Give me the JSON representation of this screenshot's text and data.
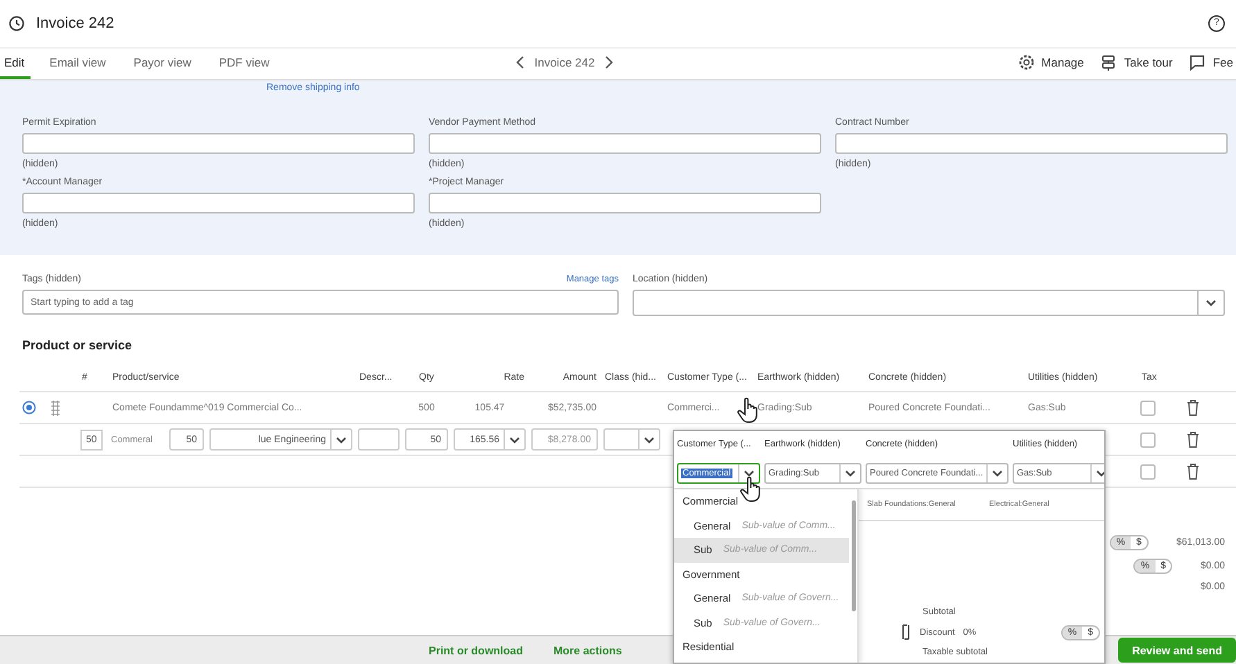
{
  "header": {
    "title": "Invoice 242",
    "help": "?"
  },
  "tabs": [
    {
      "label": "Edit",
      "selected": true
    },
    {
      "label": "Email view",
      "selected": false
    },
    {
      "label": "Payor view",
      "selected": false
    },
    {
      "label": "PDF view",
      "selected": false
    }
  ],
  "pager": {
    "title": "Invoice 242"
  },
  "toolbar": [
    {
      "label": "Manage"
    },
    {
      "label": "Take tour"
    },
    {
      "label": "Fee"
    }
  ],
  "shipping_link": "Remove shipping info",
  "custom_fields": [
    {
      "label": "Permit Expiration",
      "note": "(hidden)"
    },
    {
      "label": "Vendor Payment Method",
      "note": "(hidden)"
    },
    {
      "label": "Contract Number",
      "note": "(hidden)"
    },
    {
      "label": "*Account Manager",
      "note": "(hidden)"
    },
    {
      "label": "*Project Manager",
      "note": "(hidden)"
    }
  ],
  "tags": {
    "label": "Tags (hidden)",
    "manage_link": "Manage tags",
    "placeholder": "Start typing to add a tag"
  },
  "location": {
    "label": "Location (hidden)"
  },
  "section_title": "Product or service",
  "table": {
    "columns": [
      "#",
      "Product/service",
      "Descr...",
      "Qty",
      "Rate",
      "Amount",
      "Class (hid...",
      "Customer Type (...",
      "Earthwork (hidden)",
      "Concrete (hidden)",
      "Utilities (hidden)",
      "Tax"
    ],
    "rows": [
      {
        "kind": "item",
        "product": "Comete Foundamme^019 Commercial Co...",
        "qty": "500",
        "rate": "105.47",
        "amount": "$52,735.00",
        "customer_type": "Commerci...",
        "earthwork": "Grading:Sub",
        "concrete": "Poured Concrete Foundati...",
        "utilities": "Gas:Sub",
        "taxable": false
      },
      {
        "kind": "editing",
        "badge": "50",
        "product_text": "Commeral",
        "product_qty": "50",
        "product": "lue Engineering",
        "qty": "50",
        "rate": "165.56",
        "amount": "$8,278.00",
        "taxable": false
      },
      {
        "kind": "empty",
        "taxable": false
      }
    ]
  },
  "popup": {
    "columns": [
      "Customer Type (...",
      "Earthwork (hidden)",
      "Concrete (hidden)",
      "Utilities (hidden)"
    ],
    "selects": [
      {
        "value": "Commercial",
        "selected": true
      },
      {
        "value": "Grading:Sub",
        "selected": false
      },
      {
        "value": "Poured Concrete Foundati...",
        "selected": false
      },
      {
        "value": "Gas:Sub",
        "selected": false
      }
    ],
    "options": [
      {
        "kind": "group",
        "label": "Commercial",
        "selected": false
      },
      {
        "kind": "sub",
        "label": "General",
        "hint": "Sub-value of Comm...",
        "selected": false
      },
      {
        "kind": "sub",
        "label": "Sub",
        "hint": "Sub-value of Comm...",
        "selected": true
      },
      {
        "kind": "group",
        "label": "Government",
        "selected": false
      },
      {
        "kind": "sub",
        "label": "General",
        "hint": "Sub-value of Govern...",
        "selected": false
      },
      {
        "kind": "sub",
        "label": "Sub",
        "hint": "Sub-value of Govern...",
        "selected": false
      },
      {
        "kind": "group",
        "label": "Residential",
        "selected": false
      }
    ],
    "cells": [
      "Slab Foundations:General",
      "Electrical:General"
    ],
    "summary": {
      "subtotal": "Subtotal",
      "discount": "Discount",
      "discount_value": "0%",
      "toggle": [
        "%",
        "$"
      ],
      "taxable": "Taxable subtotal"
    }
  },
  "totals": {
    "toggles": [
      [
        "%",
        "$"
      ],
      [
        "%",
        "$"
      ]
    ],
    "amounts": [
      "$61,013.00",
      "$0.00",
      "$0.00"
    ]
  },
  "footer": {
    "links": [
      "Print or download",
      "More actions"
    ],
    "primary": "Review and send"
  }
}
